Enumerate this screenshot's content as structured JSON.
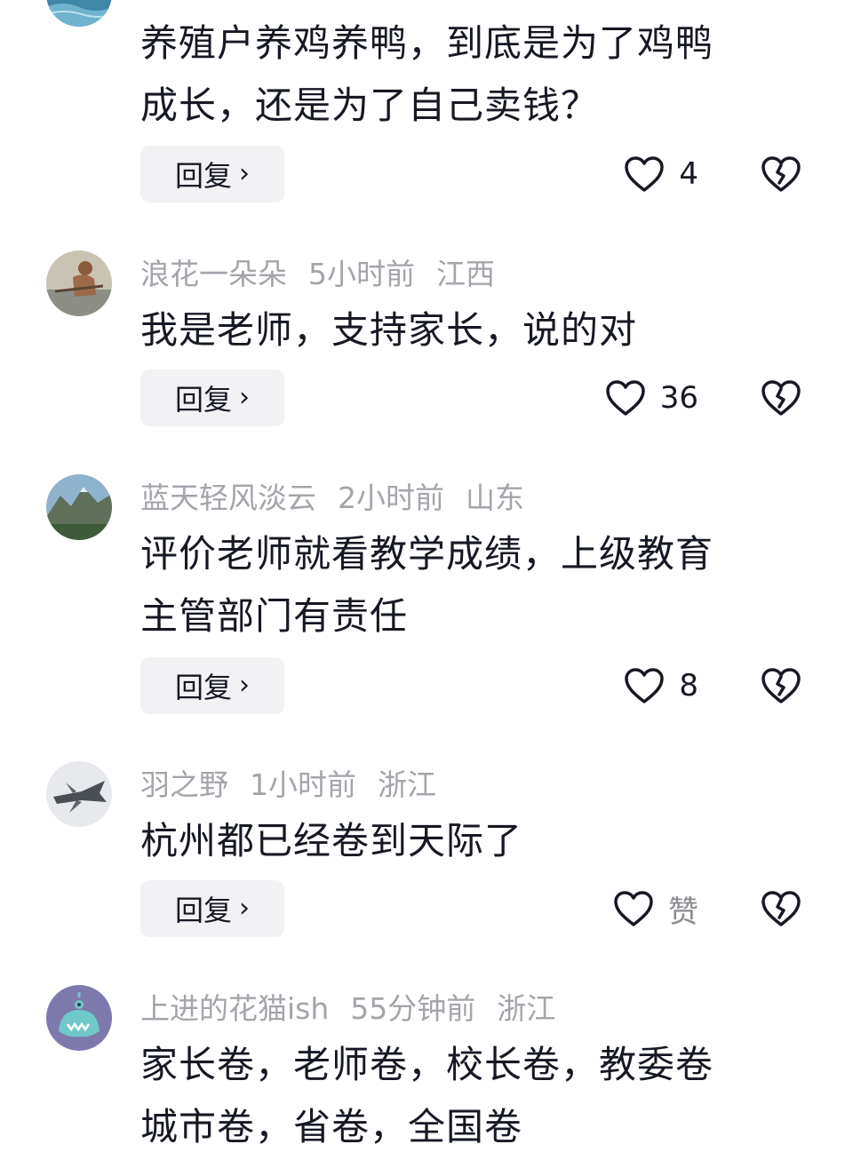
{
  "reply_label": "回复",
  "chevron_glyph": "›",
  "comments": [
    {
      "username": "",
      "time": "",
      "location": "",
      "text_lines": [
        "养殖户养鸡养鸭，到底是为了鸡鸭",
        "成长，还是为了自己卖钱？"
      ],
      "likes": "4",
      "avatar_icon": "water-avatar-icon"
    },
    {
      "username": "浪花一朵朵",
      "time": "5小时前",
      "location": "江西",
      "text_lines": [
        "我是老师，支持家长，说的对"
      ],
      "likes": "36",
      "avatar_icon": "rower-avatar-icon"
    },
    {
      "username": "蓝天轻风淡云",
      "time": "2小时前",
      "location": "山东",
      "text_lines": [
        "评价老师就看教学成绩，上级教育",
        "主管部门有责任"
      ],
      "likes": "8",
      "avatar_icon": "mountain-avatar-icon"
    },
    {
      "username": "羽之野",
      "time": "1小时前",
      "location": "浙江",
      "text_lines": [
        "杭州都已经卷到天际了"
      ],
      "likes": "赞",
      "avatar_icon": "jet-avatar-icon"
    },
    {
      "username": "上进的花猫ish",
      "time": "55分钟前",
      "location": "浙江",
      "text_lines": [
        "家长卷，老师卷，校长卷，教委卷",
        "城市卷，省卷，全国卷"
      ],
      "likes": "",
      "avatar_icon": "monster-avatar-icon"
    }
  ],
  "colors": {
    "text": "#161823",
    "meta": "#a3a5ab",
    "reply_bg": "#f2f2f4",
    "background": "#ffffff"
  }
}
